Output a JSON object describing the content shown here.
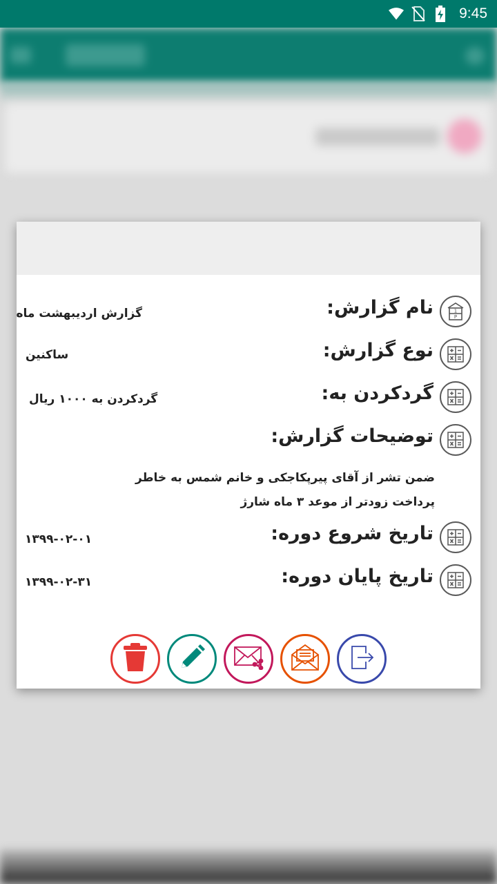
{
  "status_bar": {
    "time": "9:45",
    "icons": [
      "wifi-icon",
      "no-sim-icon",
      "battery-charging-icon"
    ]
  },
  "dialog": {
    "fields": [
      {
        "label": "نام گزارش:",
        "value": "گزارش اردیبهشت ماه",
        "icon": "report-name-icon"
      },
      {
        "label": "نوع گزارش:",
        "value": "ساکنین",
        "icon": "calculator-icon"
      },
      {
        "label": "گردکردن به:",
        "value": "گردکردن به ۱۰۰۰ ریال",
        "icon": "calculator-icon"
      },
      {
        "label": "توضیحات گزارش:",
        "value": "",
        "icon": "calculator-icon"
      },
      {
        "label": "تاریخ شروع دوره:",
        "value": "۱۳۹۹-۰۲-۰۱",
        "icon": "calculator-icon"
      },
      {
        "label": "تاریخ پایان دوره:",
        "value": "۱۳۹۹-۰۲-۳۱",
        "icon": "calculator-icon"
      }
    ],
    "description_lines": [
      "ضمن تشر از آقای پیرپکاجکی و خانم شمس به خاطر",
      "پرداخت زودتر از موعد ۳ ماه شارژ"
    ],
    "actions": [
      {
        "name": "delete-button",
        "icon": "trash-icon",
        "color": "#e53935"
      },
      {
        "name": "edit-button",
        "icon": "pencil-icon",
        "color": "#00897b"
      },
      {
        "name": "share-mail-button",
        "icon": "mail-share-icon",
        "color": "#c2185b"
      },
      {
        "name": "open-mail-button",
        "icon": "open-envelope-icon",
        "color": "#e65100"
      },
      {
        "name": "exit-button",
        "icon": "exit-icon",
        "color": "#3949ab"
      }
    ]
  }
}
